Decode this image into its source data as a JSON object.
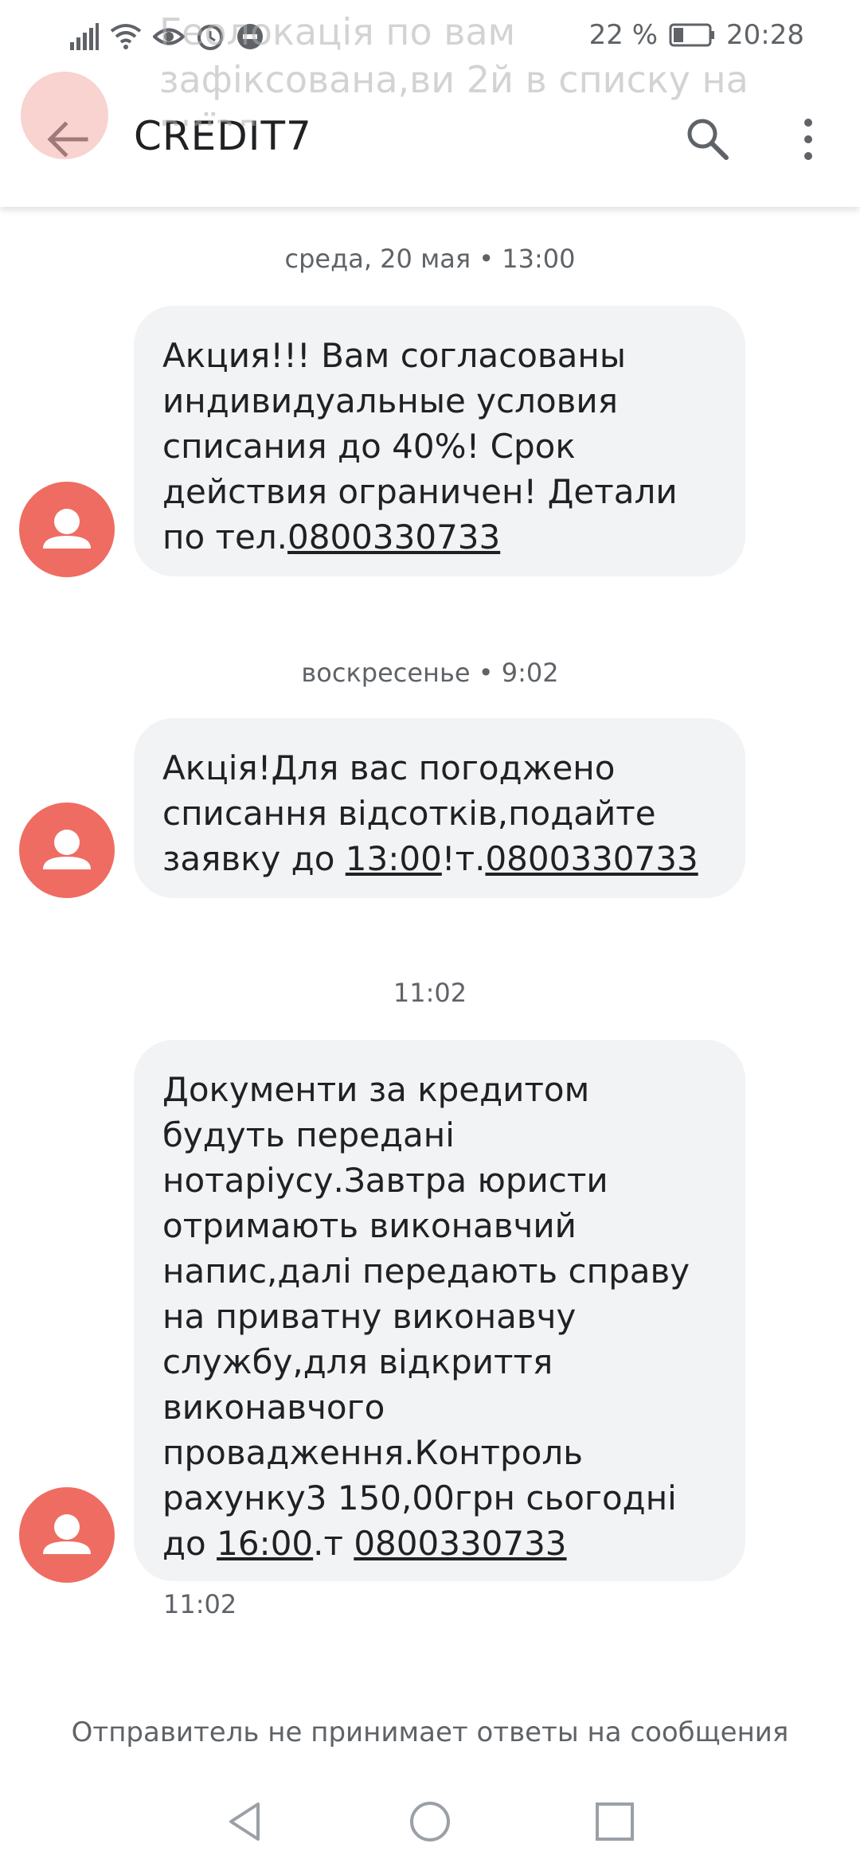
{
  "status_bar": {
    "battery_percent": "22 %",
    "time": "20:28",
    "icons": [
      "signal-icon",
      "wifi-icon",
      "eye-icon",
      "alarm-icon",
      "do-not-disturb-icon",
      "battery-icon"
    ]
  },
  "notification_overlay": {
    "line1": "Геолокація по вам",
    "line2": "зафіксована,ви 2й в списку на",
    "line3": "виїзд"
  },
  "app_bar": {
    "title": "CREDIT7",
    "back_icon": "arrow-left-icon",
    "search_icon": "search-icon",
    "menu_icon": "more-vert-icon"
  },
  "messages": [
    {
      "date_label": "среда, 20 мая • 13:00",
      "text_parts": [
        {
          "text": "Акция!!! Вам согласованы индивидуальные условия списания до 40%! Срок действия ограничен! Детали по тел.",
          "link": false
        },
        {
          "text": "0800330733",
          "link": true
        }
      ]
    },
    {
      "date_label": "воскресенье • 9:02",
      "text_parts": [
        {
          "text": "Акція!Для вас погоджено списання відсотків,подайте заявку до ",
          "link": false
        },
        {
          "text": "13:00",
          "link": true
        },
        {
          "text": "!т.",
          "link": false
        },
        {
          "text": "0800330733",
          "link": true
        }
      ]
    },
    {
      "date_label": "11:02",
      "text_parts": [
        {
          "text": "Документи за кредитом будуть передані нотаріусу.Завтра юристи отримають виконавчий напис,далі передають справу на приватну виконавчу службу,для відкриття виконавчого провадження.Контроль рахунку3 150,00грн сьогодні до ",
          "link": false
        },
        {
          "text": "16:00",
          "link": true
        },
        {
          "text": ".т ",
          "link": false
        },
        {
          "text": "0800330733",
          "link": true
        }
      ],
      "time_below": "11:02"
    }
  ],
  "footer_note": "Отправитель не принимает ответы на сообщения",
  "colors": {
    "avatar": "#ef6c62",
    "bubble": "#f1f3f4",
    "text_secondary": "#5f6368"
  }
}
